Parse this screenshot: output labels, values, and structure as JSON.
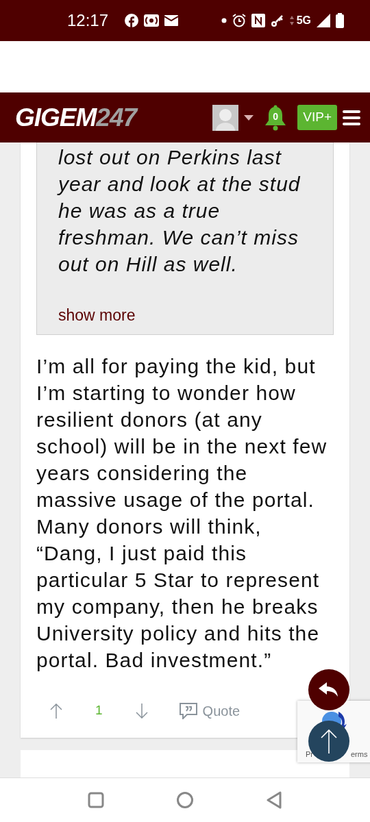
{
  "status_bar": {
    "time": "12:17",
    "network": "5G"
  },
  "header": {
    "logo_main": "GIGEM",
    "logo_accent": "247",
    "notification_count": "0",
    "vip_label": "VIP+"
  },
  "post": {
    "quote": {
      "text": "lost out on Perkins last year and look at the stud he was as a true freshman. We can’t miss out on Hill as well.",
      "show_more": "show more"
    },
    "body": "I’m all for paying the kid, but I’m starting to wonder how resilient donors (at any school) will be in the next few years considering the massive usage of the portal. Many donors will think, “Dang, I just paid this particular 5 Star to represent my company, then he breaks University policy and hits the portal. Bad investment.”",
    "vote_count": "1",
    "quote_label": "Quote"
  },
  "recaptcha": {
    "left_text": "Pr",
    "right_text": "erms"
  }
}
